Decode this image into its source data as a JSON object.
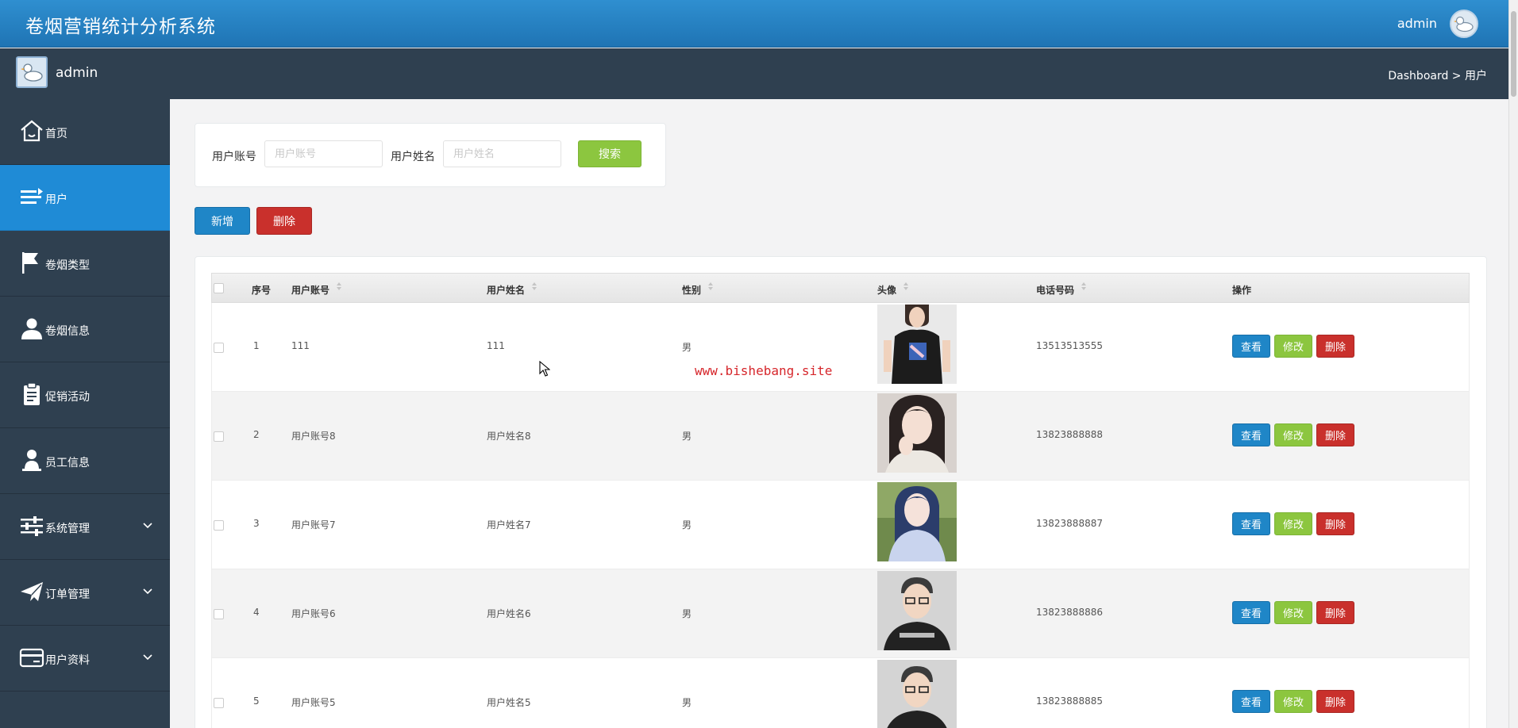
{
  "header": {
    "app_title": "卷烟营销统计分析系统",
    "user": "admin"
  },
  "subbar": {
    "user": "admin",
    "breadcrumb": "Dashboard > 用户"
  },
  "sidebar": {
    "items": [
      {
        "label": "首页",
        "icon": "home-icon"
      },
      {
        "label": "用户",
        "icon": "list-icon",
        "active": true
      },
      {
        "label": "卷烟类型",
        "icon": "flag-icon"
      },
      {
        "label": "卷烟信息",
        "icon": "user-icon"
      },
      {
        "label": "促销活动",
        "icon": "clipboard-icon"
      },
      {
        "label": "员工信息",
        "icon": "person-icon"
      },
      {
        "label": "系统管理",
        "icon": "sliders-icon",
        "expandable": true
      },
      {
        "label": "订单管理",
        "icon": "paper-plane-icon",
        "expandable": true
      },
      {
        "label": "用户资料",
        "icon": "card-icon",
        "expandable": true
      }
    ]
  },
  "search": {
    "account_label": "用户账号",
    "account_placeholder": "用户账号",
    "name_label": "用户姓名",
    "name_placeholder": "用户姓名",
    "button": "搜索"
  },
  "toolbar": {
    "add": "新增",
    "delete": "删除"
  },
  "table": {
    "columns": [
      "序号",
      "用户账号",
      "用户姓名",
      "性别",
      "头像",
      "电话号码",
      "操作"
    ],
    "rows": [
      {
        "index": "1",
        "account": "111",
        "name": "111",
        "gender": "男",
        "phone": "13513513555"
      },
      {
        "index": "2",
        "account": "用户账号8",
        "name": "用户姓名8",
        "gender": "男",
        "phone": "13823888888"
      },
      {
        "index": "3",
        "account": "用户账号7",
        "name": "用户姓名7",
        "gender": "男",
        "phone": "13823888887"
      },
      {
        "index": "4",
        "account": "用户账号6",
        "name": "用户姓名6",
        "gender": "男",
        "phone": "13823888886"
      },
      {
        "index": "5",
        "account": "用户账号5",
        "name": "用户姓名5",
        "gender": "男",
        "phone": "13823888885"
      }
    ],
    "actions": {
      "view": "查看",
      "edit": "修改",
      "delete": "删除"
    }
  },
  "watermark": "www.bishebang.site",
  "colors": {
    "header": "#1f74b4",
    "sidebar": "#2f4050",
    "active": "#1f8bd6",
    "primary": "#1f86c7",
    "success": "#8cc63f",
    "danger": "#c9302c"
  }
}
